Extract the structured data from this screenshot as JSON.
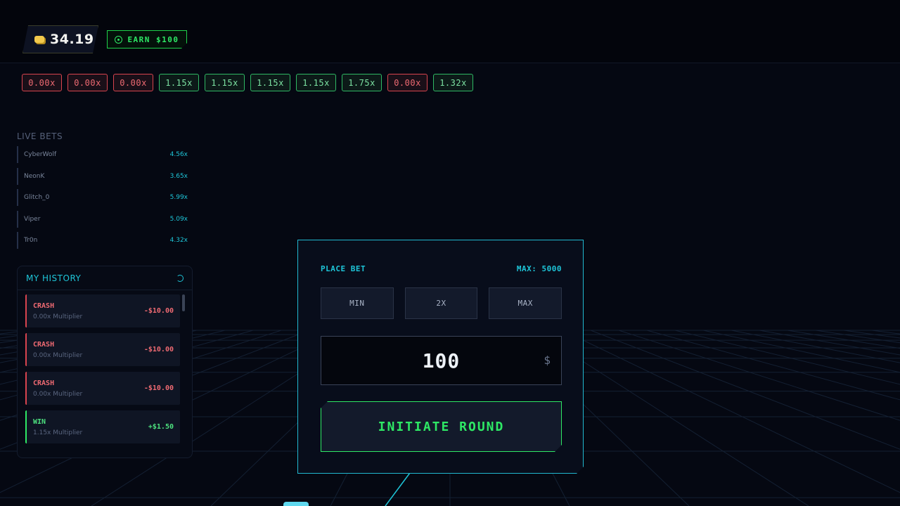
{
  "topbar": {
    "balance": "34.19",
    "earn_label": "EARN $100"
  },
  "recent_multipliers": [
    {
      "value": "0.00x",
      "status": "crash"
    },
    {
      "value": "0.00x",
      "status": "crash"
    },
    {
      "value": "0.00x",
      "status": "crash"
    },
    {
      "value": "1.15x",
      "status": "win"
    },
    {
      "value": "1.15x",
      "status": "win"
    },
    {
      "value": "1.15x",
      "status": "win"
    },
    {
      "value": "1.15x",
      "status": "win"
    },
    {
      "value": "1.75x",
      "status": "win"
    },
    {
      "value": "0.00x",
      "status": "crash"
    },
    {
      "value": "1.32x",
      "status": "win"
    }
  ],
  "live_bets": {
    "title": "LIVE BETS",
    "items": [
      {
        "name": "CyberWolf",
        "multiplier": "4.56x"
      },
      {
        "name": "NeonK",
        "multiplier": "3.65x"
      },
      {
        "name": "Glitch_0",
        "multiplier": "5.99x"
      },
      {
        "name": "Viper",
        "multiplier": "5.09x"
      },
      {
        "name": "Tr0n",
        "multiplier": "4.32x"
      }
    ]
  },
  "history": {
    "title": "MY HISTORY",
    "items": [
      {
        "result": "CRASH",
        "detail": "0.00x Multiplier",
        "amount": "-$10.00",
        "status": "loss"
      },
      {
        "result": "CRASH",
        "detail": "0.00x Multiplier",
        "amount": "-$10.00",
        "status": "loss"
      },
      {
        "result": "CRASH",
        "detail": "0.00x Multiplier",
        "amount": "-$10.00",
        "status": "loss"
      },
      {
        "result": "WIN",
        "detail": "1.15x Multiplier",
        "amount": "+$1.50",
        "status": "win"
      }
    ]
  },
  "bet_panel": {
    "title": "PLACE BET",
    "max_label": "MAX: 5000",
    "quick": {
      "min": "MIN",
      "double": "2X",
      "max": "MAX"
    },
    "amount": "100",
    "currency": "$",
    "submit": "INITIATE ROUND"
  },
  "colors": {
    "accent_cyan": "#1ec5d8",
    "win_green": "#2ee865",
    "loss_red": "#d8444e",
    "coin_gold": "#f2c94c"
  },
  "icons": [
    "coin-icon",
    "plus-circle-icon",
    "history-icon"
  ]
}
